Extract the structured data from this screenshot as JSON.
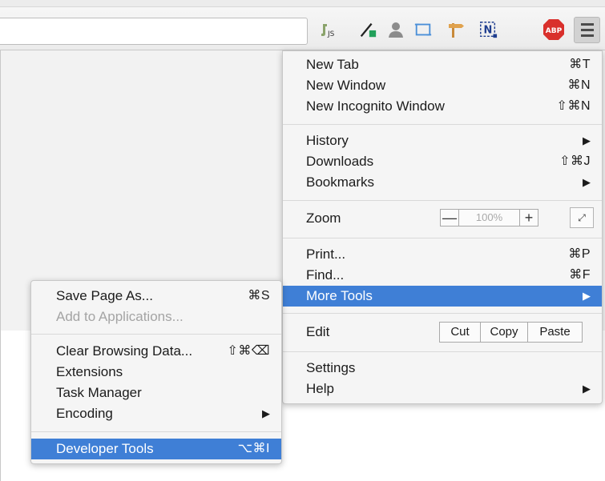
{
  "toolbar": {
    "extensions": [
      {
        "icon": "js-extension-icon"
      },
      {
        "icon": "eyedropper-icon"
      },
      {
        "icon": "person-icon"
      },
      {
        "icon": "screen-capture-icon"
      },
      {
        "icon": "signpost-icon"
      },
      {
        "icon": "n-selection-icon",
        "text": "N"
      },
      {
        "icon": "adblock-plus-icon",
        "text": "ABP"
      }
    ],
    "menu_icon": "hamburger-menu-icon"
  },
  "menu": {
    "new_tab": {
      "label": "New Tab",
      "shortcut": "⌘T"
    },
    "new_window": {
      "label": "New Window",
      "shortcut": "⌘N"
    },
    "new_incognito": {
      "label": "New Incognito Window",
      "shortcut": "⇧⌘N"
    },
    "history": {
      "label": "History",
      "arrow": "▶"
    },
    "downloads": {
      "label": "Downloads",
      "shortcut": "⇧⌘J"
    },
    "bookmarks": {
      "label": "Bookmarks",
      "arrow": "▶"
    },
    "zoom": {
      "label": "Zoom",
      "minus": "—",
      "value": "100%",
      "plus": "+",
      "fullscreen": "⤢"
    },
    "print": {
      "label": "Print...",
      "shortcut": "⌘P"
    },
    "find": {
      "label": "Find...",
      "shortcut": "⌘F"
    },
    "more_tools": {
      "label": "More Tools",
      "arrow": "▶"
    },
    "edit": {
      "label": "Edit",
      "cut": "Cut",
      "copy": "Copy",
      "paste": "Paste"
    },
    "settings": {
      "label": "Settings"
    },
    "help": {
      "label": "Help",
      "arrow": "▶"
    }
  },
  "submenu": {
    "save_page": {
      "label": "Save Page As...",
      "shortcut": "⌘S"
    },
    "add_to_apps": {
      "label": "Add to Applications..."
    },
    "clear_data": {
      "label": "Clear Browsing Data...",
      "shortcut": "⇧⌘⌫"
    },
    "extensions": {
      "label": "Extensions"
    },
    "task_manager": {
      "label": "Task Manager"
    },
    "encoding": {
      "label": "Encoding",
      "arrow": "▶"
    },
    "dev_tools": {
      "label": "Developer Tools",
      "shortcut": "⌥⌘I"
    }
  },
  "colors": {
    "highlight": "#3f7fd6",
    "menu_bg": "#f5f5f5",
    "abp_red": "#d9302c"
  }
}
